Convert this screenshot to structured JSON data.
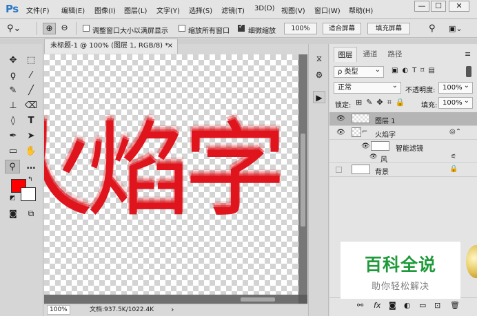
{
  "app": {
    "logo": "Ps"
  },
  "menu": [
    "文件(F)",
    "编辑(E)",
    "图像(I)",
    "图层(L)",
    "文字(Y)",
    "选择(S)",
    "滤镜(T)",
    "3D(D)",
    "视图(V)",
    "窗口(W)",
    "帮助(H)"
  ],
  "window_controls": {
    "minimize": "—",
    "restore": "☐",
    "close": "✕"
  },
  "options": {
    "resize_windows_label": "调整窗口大小以满屏显示",
    "resize_windows_checked": false,
    "zoom_all_label": "缩放所有窗口",
    "zoom_all_checked": false,
    "scrubby_label": "细微缩放",
    "scrubby_checked": true,
    "zoom_100": "100%",
    "fit_screen": "适合屏幕",
    "fill_screen": "填充屏幕"
  },
  "document": {
    "tab_title": "未标题-1 @ 100% (图层 1, RGB/8) *",
    "close": "×",
    "canvas_text": "火焰字",
    "text_color": "#e0141c"
  },
  "status": {
    "zoom": "100%",
    "doc_info": "文档:937.5K/1022.4K",
    "arrow": "›"
  },
  "colors": {
    "foreground": "#ff0000",
    "background": "#ffffff"
  },
  "panel": {
    "tabs": [
      "图层",
      "通道",
      "路径"
    ],
    "filter_label": "ρ 类型",
    "blend_mode": "正常",
    "opacity_label": "不透明度:",
    "opacity_value": "100%",
    "lock_label": "锁定:",
    "fill_label": "填充:",
    "fill_value": "100%",
    "layers": [
      {
        "name": "图层 1",
        "selected": true,
        "visible": true
      },
      {
        "name": "火焰字",
        "selected": false,
        "visible": true
      },
      {
        "name": "智能滤镜",
        "selected": false,
        "visible": true
      },
      {
        "name": "风",
        "selected": false,
        "visible": true
      },
      {
        "name": "背景",
        "selected": false,
        "visible": false
      }
    ]
  },
  "watermark": {
    "title": "百科全说",
    "subtitle": "助你轻松解决"
  }
}
